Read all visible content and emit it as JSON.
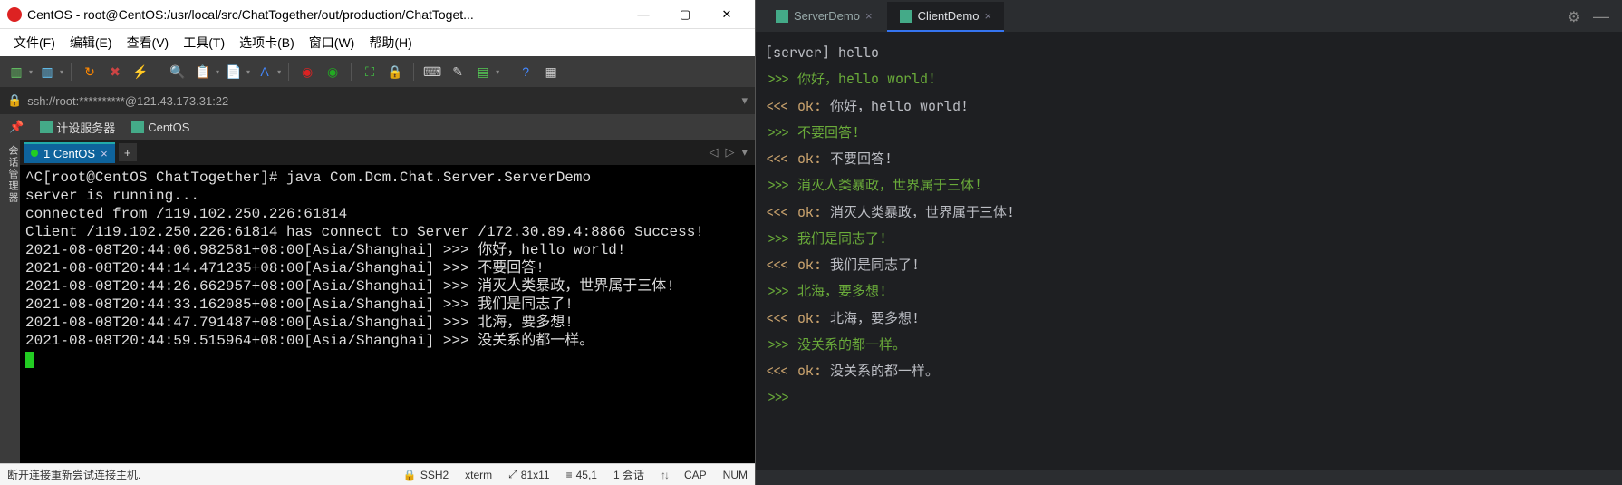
{
  "left": {
    "title": "CentOS - root@CentOS:/usr/local/src/ChatTogether/out/production/ChatToget...",
    "menu": [
      "文件(F)",
      "编辑(E)",
      "查看(V)",
      "工具(T)",
      "选项卡(B)",
      "窗口(W)",
      "帮助(H)"
    ],
    "address": "ssh://root:**********@121.43.173.31:22",
    "bookmarks": [
      {
        "label": "计设服务器"
      },
      {
        "label": "CentOS"
      }
    ],
    "sidebar_label": "会话管理器",
    "tab_label": "1 CentOS",
    "terminal_lines": [
      "^C[root@CentOS ChatTogether]# java Com.Dcm.Chat.Server.ServerDemo",
      "server is running...",
      "connected from /119.102.250.226:61814",
      "Client /119.102.250.226:61814 has connect to Server /172.30.89.4:8866 Success!",
      "2021-08-08T20:44:06.982581+08:00[Asia/Shanghai] >>> 你好，hello world!",
      "2021-08-08T20:44:14.471235+08:00[Asia/Shanghai] >>> 不要回答!",
      "2021-08-08T20:44:26.662957+08:00[Asia/Shanghai] >>> 消灭人类暴政，世界属于三体!",
      "2021-08-08T20:44:33.162085+08:00[Asia/Shanghai] >>> 我们是同志了!",
      "2021-08-08T20:44:47.791487+08:00[Asia/Shanghai] >>> 北海，要多想!",
      "2021-08-08T20:44:59.515964+08:00[Asia/Shanghai] >>> 没关系的都一样。"
    ],
    "status": {
      "left_text": "断开连接重新尝试连接主机.",
      "ssh": "SSH2",
      "term": "xterm",
      "size": "81x11",
      "pos": "45,1",
      "sessions": "1 会话",
      "cap": "CAP",
      "num": "NUM"
    }
  },
  "right": {
    "tabs": [
      {
        "label": "ServerDemo",
        "active": false
      },
      {
        "label": "ClientDemo",
        "active": true
      }
    ],
    "console": [
      {
        "segs": [
          {
            "t": "[server] hello",
            "c": "gray"
          }
        ]
      },
      {
        "segs": [
          {
            "t": ">>> ",
            "c": "prompt"
          },
          {
            "t": "你好，hello world!",
            "c": "green"
          }
        ]
      },
      {
        "segs": [
          {
            "t": "<<< ",
            "c": "yellow"
          },
          {
            "t": "ok: ",
            "c": "yellow"
          },
          {
            "t": "你好，hello world!",
            "c": "gray"
          }
        ]
      },
      {
        "segs": [
          {
            "t": ">>> ",
            "c": "prompt"
          },
          {
            "t": "不要回答!",
            "c": "green"
          }
        ]
      },
      {
        "segs": [
          {
            "t": "<<< ",
            "c": "yellow"
          },
          {
            "t": "ok: ",
            "c": "yellow"
          },
          {
            "t": "不要回答!",
            "c": "gray"
          }
        ]
      },
      {
        "segs": [
          {
            "t": ">>> ",
            "c": "prompt"
          },
          {
            "t": "消灭人类暴政，世界属于三体!",
            "c": "green"
          }
        ]
      },
      {
        "segs": [
          {
            "t": "<<< ",
            "c": "yellow"
          },
          {
            "t": "ok: ",
            "c": "yellow"
          },
          {
            "t": "消灭人类暴政，世界属于三体!",
            "c": "gray"
          }
        ]
      },
      {
        "segs": [
          {
            "t": ">>> ",
            "c": "prompt"
          },
          {
            "t": "我们是同志了!",
            "c": "green"
          }
        ]
      },
      {
        "segs": [
          {
            "t": "<<< ",
            "c": "yellow"
          },
          {
            "t": "ok: ",
            "c": "yellow"
          },
          {
            "t": "我们是同志了!",
            "c": "gray"
          }
        ]
      },
      {
        "segs": [
          {
            "t": ">>> ",
            "c": "prompt"
          },
          {
            "t": "北海，要多想!",
            "c": "green"
          }
        ]
      },
      {
        "segs": [
          {
            "t": "<<< ",
            "c": "yellow"
          },
          {
            "t": "ok: ",
            "c": "yellow"
          },
          {
            "t": "北海，要多想!",
            "c": "gray"
          }
        ]
      },
      {
        "segs": [
          {
            "t": ">>> ",
            "c": "prompt"
          },
          {
            "t": "没关系的都一样。",
            "c": "green"
          }
        ]
      },
      {
        "segs": [
          {
            "t": "<<< ",
            "c": "yellow"
          },
          {
            "t": "ok: ",
            "c": "yellow"
          },
          {
            "t": "没关系的都一样。",
            "c": "gray"
          }
        ]
      },
      {
        "segs": [
          {
            "t": ">>>",
            "c": "prompt"
          }
        ]
      }
    ]
  }
}
